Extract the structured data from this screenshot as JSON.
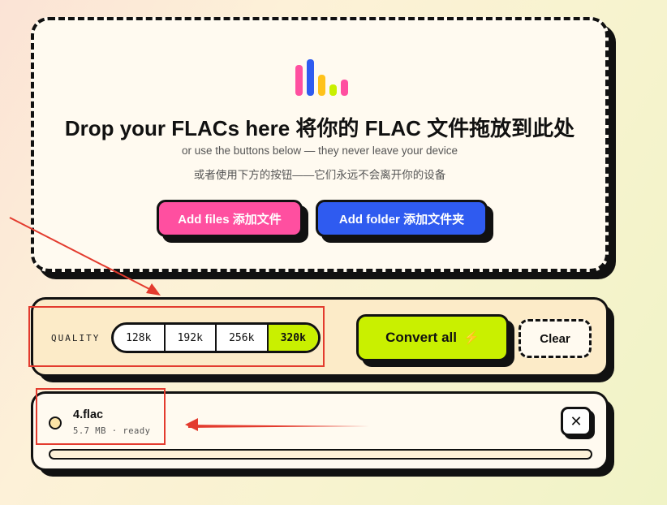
{
  "drop_zone": {
    "title": "Drop your FLACs here 将你的 FLAC 文件拖放到此处",
    "subtitle_en": "or use the buttons below — they never leave your device",
    "subtitle_zh": "或者使用下方的按钮——它们永远不会离开你的设备",
    "add_files_label": "Add files 添加文件",
    "add_folder_label": "Add folder 添加文件夹",
    "logo_colors": [
      "#ff4fa0",
      "#2f5bf0",
      "#ffc21a",
      "#c9f000",
      "#ff4fa0"
    ]
  },
  "toolbar": {
    "quality_label": "QUALITY",
    "quality_options": [
      "128k",
      "192k",
      "256k",
      "320k"
    ],
    "selected_quality": "320k",
    "convert_label": "Convert all",
    "convert_icon": "lightning-bolt-icon",
    "clear_label": "Clear"
  },
  "files": [
    {
      "name": "4.flac",
      "meta": "5.7 MB · ready",
      "progress": 0,
      "remove_label": "✕"
    }
  ],
  "colors": {
    "pink": "#ff4fa0",
    "blue": "#2f5bf0",
    "lime": "#c9f000",
    "annotation_red": "#e33b2e"
  }
}
